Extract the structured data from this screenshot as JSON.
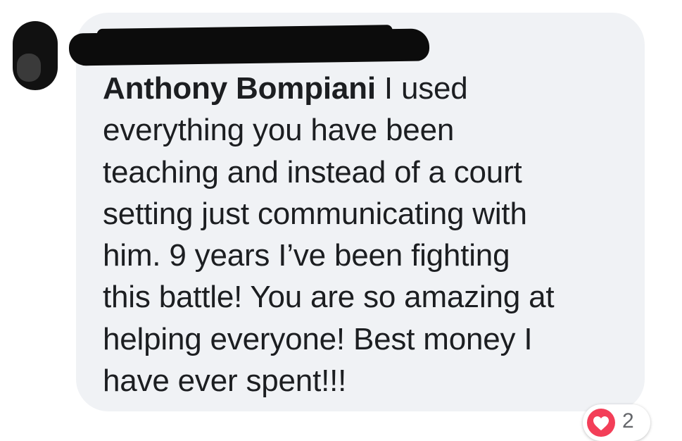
{
  "comment": {
    "author": "Anthony Bompiani",
    "lines": [
      " I used",
      "everything you have been",
      "teaching and instead of a court",
      "setting just communicating with",
      "him.  9 years I’ve been fighting",
      "this battle!  You are so amazing at",
      "helping everyone!  Best money I",
      "have ever spent!!!"
    ]
  },
  "reactions": {
    "icon": "heart-icon",
    "count": "2"
  },
  "colors": {
    "bubble": "#f0f2f5",
    "text": "#1c1e21",
    "heart": "#f33e58"
  }
}
